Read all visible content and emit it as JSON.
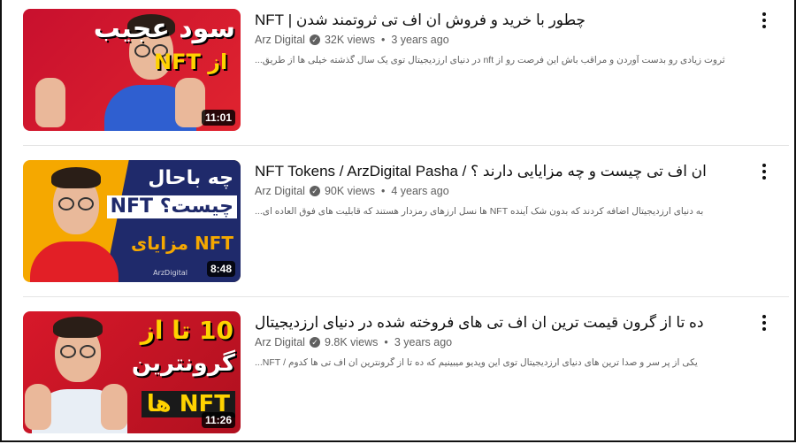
{
  "videos": [
    {
      "title": "چطور با خرید و فروش ان اف تی ثروتمند شدن | NFT",
      "channel": "Arz Digital",
      "views": "32K views",
      "age": "3 years ago",
      "description": "ثروت زیادی رو بدست آوردن و مراقب باش این فرصت رو از nft در دنیای ارزدیجیتال توی یک سال گذشته خیلی ها از طریق...",
      "duration": "11:01",
      "thumb_text": [
        "سود عجیب",
        "از NFT"
      ],
      "colors": {
        "bg": "#c8102e",
        "bg2": "#e0242f",
        "shirt": "#2f5fd0",
        "text": "#ffffff",
        "accent": "#ffd200"
      }
    },
    {
      "title": "ان اف تی چیست و چه مزایایی دارند ؟ / NFT Tokens / ArzDigital Pasha",
      "channel": "Arz Digital",
      "views": "90K views",
      "age": "4 years ago",
      "description": "به دنیای ارزدیجیتال اضافه کردند که بدون شک آینده NFT ها نسل ارزهای رمزدار هستند که قابلیت های فوق العاده ای...",
      "duration": "8:48",
      "thumb_text": [
        "چه باحال",
        "NFT چیست؟",
        "مزایای NFT",
        "ArzDigital"
      ],
      "colors": {
        "bg": "#f5a800",
        "bg2": "#1f2a6b",
        "shirt": "#e21f26",
        "text": "#1f2a6b",
        "accent": "#ffffff"
      }
    },
    {
      "title": "ده تا از گرون قیمت ترین ان اف تی های فروخته شده در دنیای ارزدیجیتال",
      "channel": "Arz Digital",
      "views": "9.8K views",
      "age": "3 years ago",
      "description": "یکی از پر سر و صدا ترین های دنیای ارزدیجیتال توی این ویدیو میبینیم که ده تا از گرونترین ان اف تی ها کدوم / NFT...",
      "duration": "11:26",
      "thumb_text": [
        "10 تا از",
        "گرونترین",
        "NFT ها"
      ],
      "colors": {
        "bg": "#d7182a",
        "bg2": "#b0101f",
        "shirt": "#e8eef5",
        "text": "#ffffff",
        "accent": "#ffd200"
      }
    }
  ],
  "icons": {
    "more": "more-vert-icon",
    "verified": "verified-check-icon"
  },
  "verified_glyph": "✓"
}
